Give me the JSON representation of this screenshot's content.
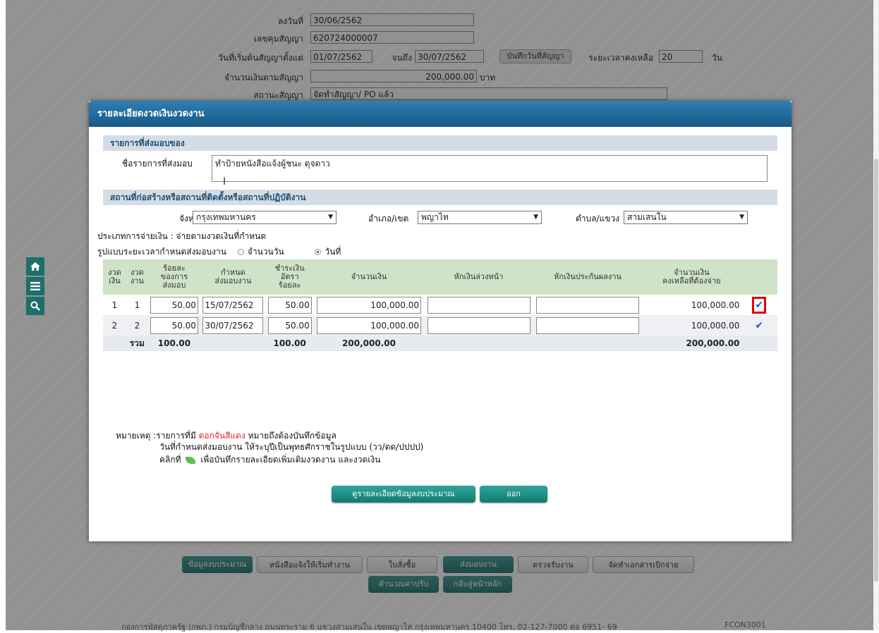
{
  "background_form": {
    "date_label": "ลงวันที่",
    "date_value": "30/06/2562",
    "contract_no_label": "เลขคุมสัญญา",
    "contract_no_value": "620724000007",
    "start_label": "วันที่เริ่มต้นสัญญาตั้งแต่",
    "start_value": "01/07/2562",
    "to_label": "จนถึง",
    "to_value": "30/07/2562",
    "save_date_button": "บันทึกวันที่สัญญา",
    "remaining_label": "ระยะเวลาคงเหลือ",
    "remaining_value": "20",
    "remaining_unit": "วัน",
    "amount_label": "จำนวนเงินตามสัญญา",
    "amount_value": "200,000.00",
    "amount_unit": "บาท",
    "status_label": "สถานะสัญญา",
    "status_value": "จัดทำสัญญา/ PO แล้ว"
  },
  "modal": {
    "title": "รายละเอียดงวดเงินงวดงาน",
    "delivery_section": "รายการที่ส่งมอบของ",
    "delivery_name_label": "ชื่อรายการที่ส่งมอบ",
    "delivery_name_value": "ทำป้ายหนังสือแจ้งผู้ชนะ ดุจดาว",
    "location_section": "สถานที่ก่อสร้างหรือสถานที่ติดตั้งหรือสถานที่ปฏิบัติงาน",
    "province_label": "จังหวัด",
    "province_value": "กรุงเทพมหานคร",
    "district_label": "อำเภอ/เขต",
    "district_value": "พญาไท",
    "subdistrict_label": "ตำบล/แขวง",
    "subdistrict_value": "สามเสนใน",
    "payment_type": "ประเภทการจ่ายเงิน : จ่ายตามงวดเงินที่กำหนด",
    "period_format_label": "รูปแบบระยะเวลากำหนดส่งมอบงาน",
    "period_option_days": "จำนวนวัน",
    "period_option_date": "วันที่",
    "period_selected": "วันที่",
    "table": {
      "headers": [
        "งวด\nเงิน",
        "งวด\nงาน",
        "ร้อยละ\nของการ\nส่งมอบ",
        "กำหนด\nส่งมอบงาน",
        "ชำระเงิน\nอัตรา\nร้อยละ",
        "จำนวนเงิน",
        "หักเงินล่วงหน้า",
        "หักเงินประกันผลงาน",
        "จำนวนเงิน\nคงเหลือที่ต้องจ่าย",
        ""
      ],
      "rows": [
        {
          "pay_no": "1",
          "work_no": "1",
          "percent": "50.00",
          "due": "15/07/2562",
          "pay_rate": "50.00",
          "amount": "100,000.00",
          "advance": "",
          "guarantee": "",
          "remaining": "100,000.00"
        },
        {
          "pay_no": "2",
          "work_no": "2",
          "percent": "50.00",
          "due": "30/07/2562",
          "pay_rate": "50.00",
          "amount": "100,000.00",
          "advance": "",
          "guarantee": "",
          "remaining": "100,000.00"
        }
      ],
      "total_label": "รวม",
      "total_percent": "100.00",
      "total_pay_rate": "100.00",
      "total_amount": "200,000.00",
      "total_remaining": "200,000.00"
    },
    "note_prefix": "หมายเหตุ :รายการที่มี",
    "note_red": "ดอกจันสีแดง",
    "note_suffix": "หมายถึงต้องบันทึกข้อมูล",
    "note_line2": "วันที่กำหนดส่งมอบงาน ให้ระบุปีเป็นพุทธศักราชในรูปแบบ (วว/ดด/ปปปป)",
    "note_line3_prefix": "คลิกที่",
    "note_line3_suffix": "เพื่อบันทึกรายละเอียดเพิ่มเติมงวดงาน และงวดเงิน",
    "budget_button": "ดูรายละเอียดข้อมูลงบประมาณ",
    "exit_button": "ออก"
  },
  "bottom_nav": {
    "buttons": [
      "ข้อมูลงบประมาณ",
      "หนังสือแจ้งให้เริ่มทำงาน",
      "ใบสั่งซื้อ",
      "ส่งมอบงาน",
      "ตรวจรับงาน",
      "จัดทำเอกสารเบิกจ่าย"
    ],
    "row2": [
      "คำนวณค่าปรับ",
      "กลับสู่หน้าหลัก"
    ]
  },
  "footer": {
    "text": "กองการพัสดุภาครัฐ (กพภ.) กรมบัญชีกลาง ถนนพระราม 6 แขวงสามเสนใน เขตพญาไท กรุงเทพมหานคร 10400 โทร. 02-127-7000 ต่อ 6951- 69",
    "code": "FCON3001"
  },
  "icons": [
    "home-icon",
    "menu-icon",
    "search-icon",
    "edit-check-icon"
  ],
  "colors": {
    "header": "#185a87",
    "accent_green": "#16625e",
    "highlight": "#e20000"
  }
}
